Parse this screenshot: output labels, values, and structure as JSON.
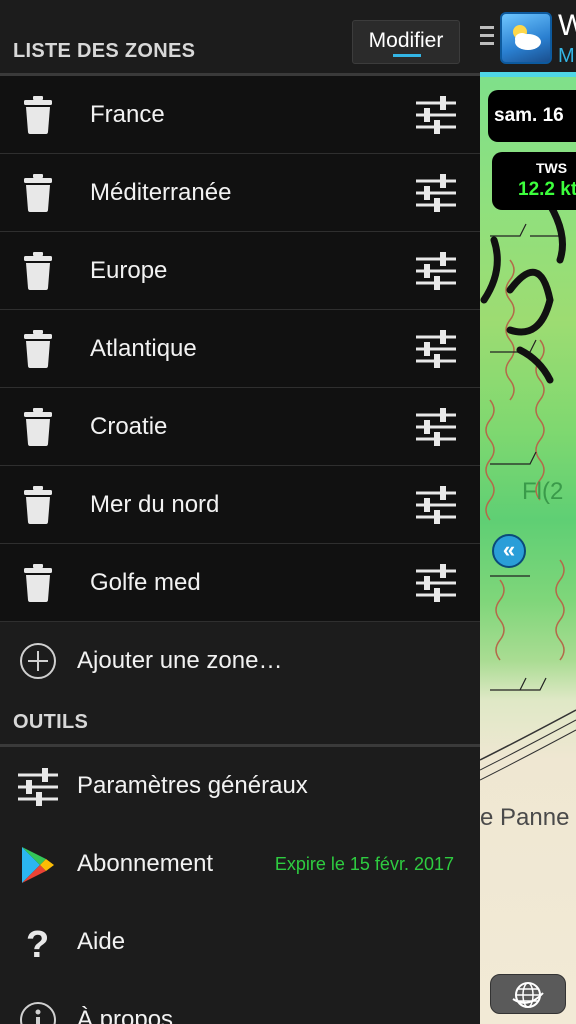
{
  "drawer": {
    "zones_title": "LISTE DES ZONES",
    "edit_label": "Modifier",
    "zones": [
      {
        "name": "France"
      },
      {
        "name": "Méditerranée"
      },
      {
        "name": "Europe"
      },
      {
        "name": "Atlantique"
      },
      {
        "name": "Croatie"
      },
      {
        "name": "Mer du nord"
      },
      {
        "name": "Golfe med"
      }
    ],
    "add_zone_label": "Ajouter une zone…",
    "tools_title": "OUTILS",
    "tools": {
      "settings_label": "Paramètres généraux",
      "subscription_label": "Abonnement",
      "subscription_expiry": "Expire le 15 févr. 2017",
      "help_label": "Aide",
      "about_label": "À propos"
    }
  },
  "map": {
    "app_title": "W",
    "app_subtitle": "M",
    "date_label": "sam. 16",
    "tws_label": "TWS",
    "tws_value": "12.2 kt",
    "chart_text_1": "Fl(2",
    "chart_text_2": "e Panne"
  },
  "colors": {
    "accent_blue": "#33b5e5",
    "expiry_green": "#2ecc40",
    "tws_green": "#3cff3c",
    "drawer_bg": "#1c1c1c"
  },
  "icons": {
    "zone_delete": "trash-icon",
    "zone_settings": "sliders-icon",
    "add": "plus-circle-icon",
    "settings": "sliders-icon",
    "subscription": "play-store-icon",
    "help": "question-icon",
    "about": "info-icon"
  }
}
